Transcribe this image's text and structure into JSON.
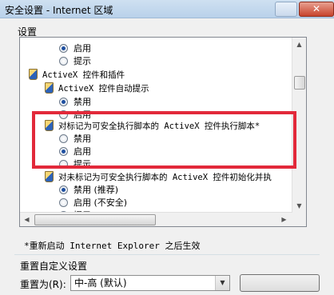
{
  "window": {
    "title": "安全设置 - Internet 区域",
    "close_glyph": "✕"
  },
  "settings": {
    "group_label": "设置",
    "items": [
      {
        "type": "radio",
        "label": "启用",
        "checked": true
      },
      {
        "type": "radio",
        "label": "提示",
        "checked": false
      },
      {
        "type": "group",
        "label": "ActiveX 控件和插件"
      },
      {
        "type": "group",
        "label": "ActiveX 控件自动提示"
      },
      {
        "type": "radio",
        "label": "禁用",
        "checked": true
      },
      {
        "type": "radio",
        "label": "启用",
        "checked": false
      },
      {
        "type": "group",
        "label": "对标记为可安全执行脚本的 ActiveX 控件执行脚本*"
      },
      {
        "type": "radio",
        "label": "禁用",
        "checked": false
      },
      {
        "type": "radio",
        "label": "启用",
        "checked": true
      },
      {
        "type": "radio",
        "label": "提示",
        "checked": false
      },
      {
        "type": "group",
        "label": "对未标记为可安全执行脚本的 ActiveX 控件初始化并执"
      },
      {
        "type": "radio",
        "label": "禁用 (推荐)",
        "checked": true
      },
      {
        "type": "radio",
        "label": "启用 (不安全)",
        "checked": false
      },
      {
        "type": "radio",
        "label": "提示",
        "checked": false
      }
    ]
  },
  "footer": {
    "restart_note": "*重新启动 Internet Explorer 之后生效",
    "reset_title": "重置自定义设置",
    "reset_label": "重置为(R):",
    "reset_value": "中-高 (默认)"
  },
  "colors": {
    "highlight_box": "#e2293a",
    "radio_selected": "#1e4fa0"
  }
}
